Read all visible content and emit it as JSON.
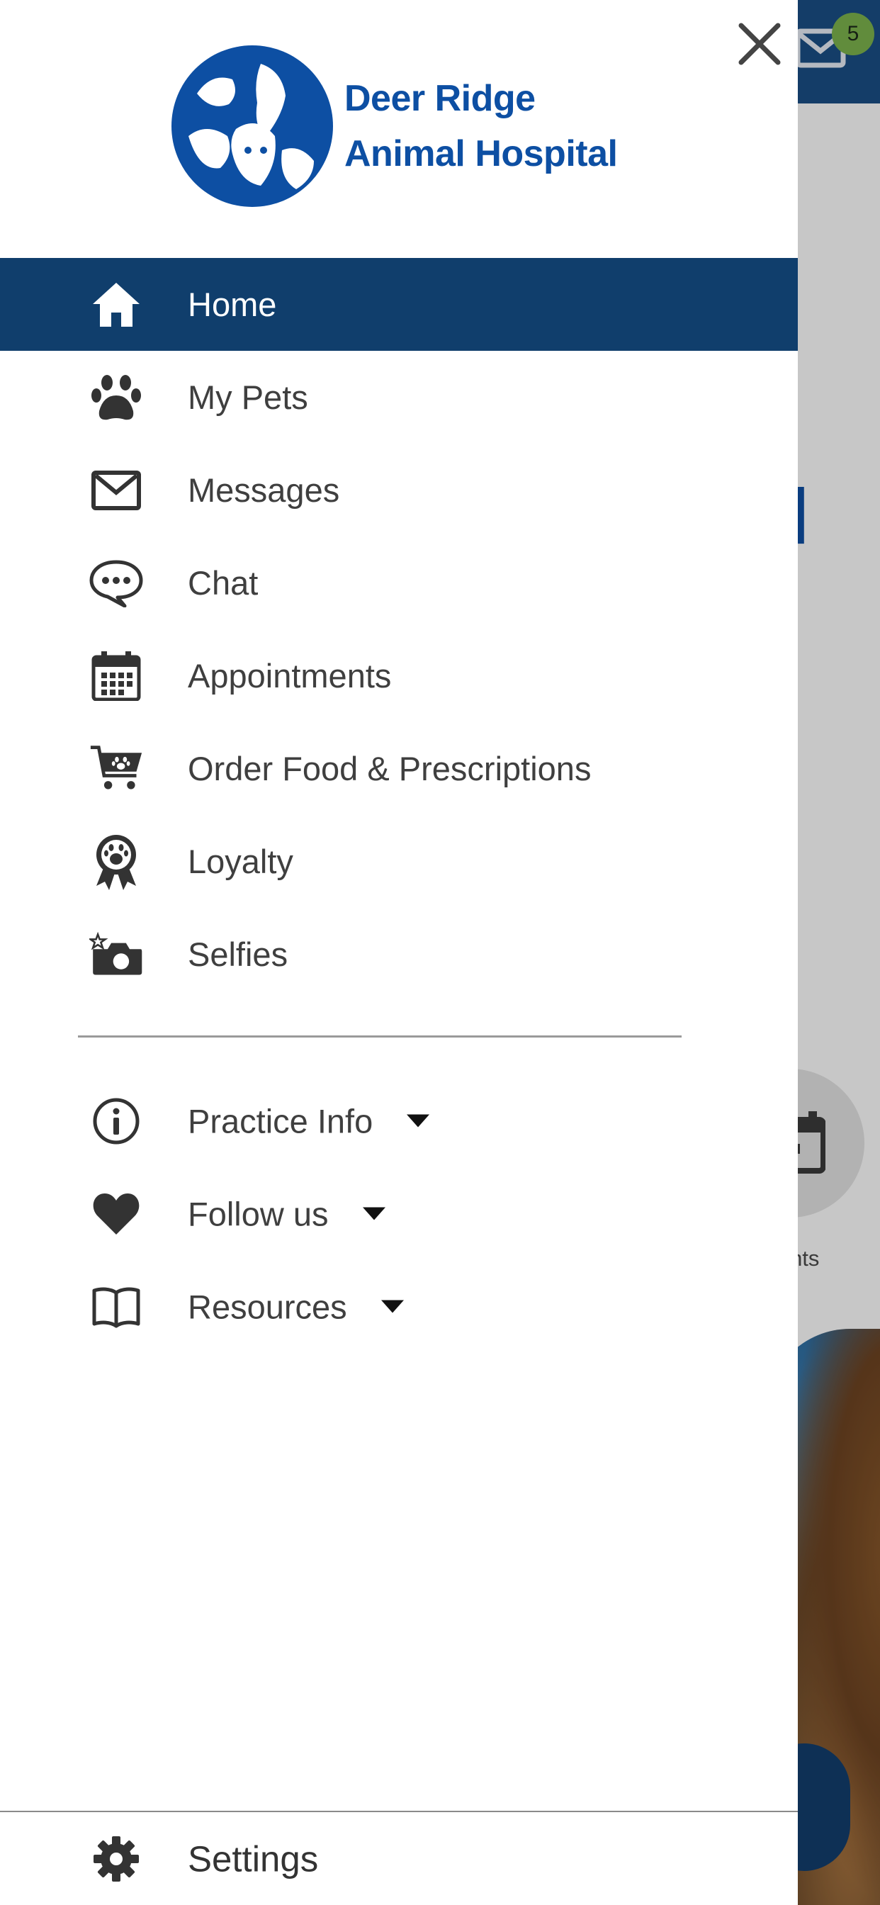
{
  "background": {
    "mail_badge_count": "5",
    "logo_fragment": "l",
    "tile_caption": "ments"
  },
  "drawer": {
    "logo": {
      "line1": "Deer Ridge",
      "line2": "Animal Hospital"
    },
    "close_icon": "close-icon",
    "items": [
      {
        "label": "Home",
        "icon": "home-icon",
        "active": true
      },
      {
        "label": "My Pets",
        "icon": "paw-icon"
      },
      {
        "label": "Messages",
        "icon": "envelope-icon"
      },
      {
        "label": "Chat",
        "icon": "chat-bubble-icon"
      },
      {
        "label": "Appointments",
        "icon": "calendar-icon"
      },
      {
        "label": "Order Food & Prescriptions",
        "icon": "cart-icon"
      },
      {
        "label": "Loyalty",
        "icon": "award-ribbon-icon"
      },
      {
        "label": "Selfies",
        "icon": "camera-icon"
      }
    ],
    "expandable": [
      {
        "label": "Practice Info",
        "icon": "info-icon"
      },
      {
        "label": "Follow us",
        "icon": "heart-icon"
      },
      {
        "label": "Resources",
        "icon": "book-icon"
      }
    ],
    "settings": {
      "label": "Settings",
      "icon": "gear-icon"
    }
  },
  "colors": {
    "brand_blue": "#0d4fa3",
    "active_bg": "#103e6c",
    "badge_green": "#7db44d"
  }
}
